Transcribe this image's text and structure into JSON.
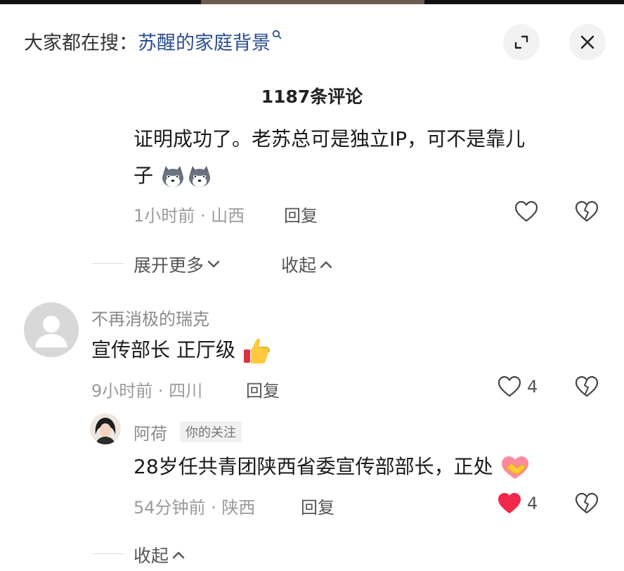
{
  "search": {
    "prefix": "大家都在搜：",
    "term": "苏醒的家庭背景"
  },
  "panel": {
    "count_title": "1187条评论"
  },
  "comments": [
    {
      "id": "c1",
      "text_line1": "证明成功了。老苏总可是独立IP，可不是靠儿",
      "text_line2": "子",
      "emojis": [
        "husky-dog-emoji",
        "husky-dog-emoji"
      ],
      "time_location": "1小时前 · 山西",
      "reply_label": "回复",
      "liked": false
    },
    {
      "id": "c2",
      "username": "不再消极的瑞克",
      "text": "宣传部长 正厅级",
      "emoji": "thumbs-up-emoji",
      "time_location": "9小时前 · 四川",
      "reply_label": "回复",
      "like_count": "4",
      "liked": false
    },
    {
      "id": "c3",
      "username": "阿荷",
      "badge": "你的关注",
      "text": "28岁任共青团陕西省委宣传部部长，正处",
      "emoji": "handshake-emoji",
      "time_location": "54分钟前 · 陕西",
      "reply_label": "回复",
      "like_count": "4",
      "liked": true
    }
  ],
  "fold": {
    "expand_more": "展开更多",
    "collapse": "收起",
    "collapse_bottom": "收起"
  },
  "colors": {
    "search_term": "#2a4d8f",
    "like_active": "#f2294a",
    "meta_gray": "#9a9a9a"
  }
}
